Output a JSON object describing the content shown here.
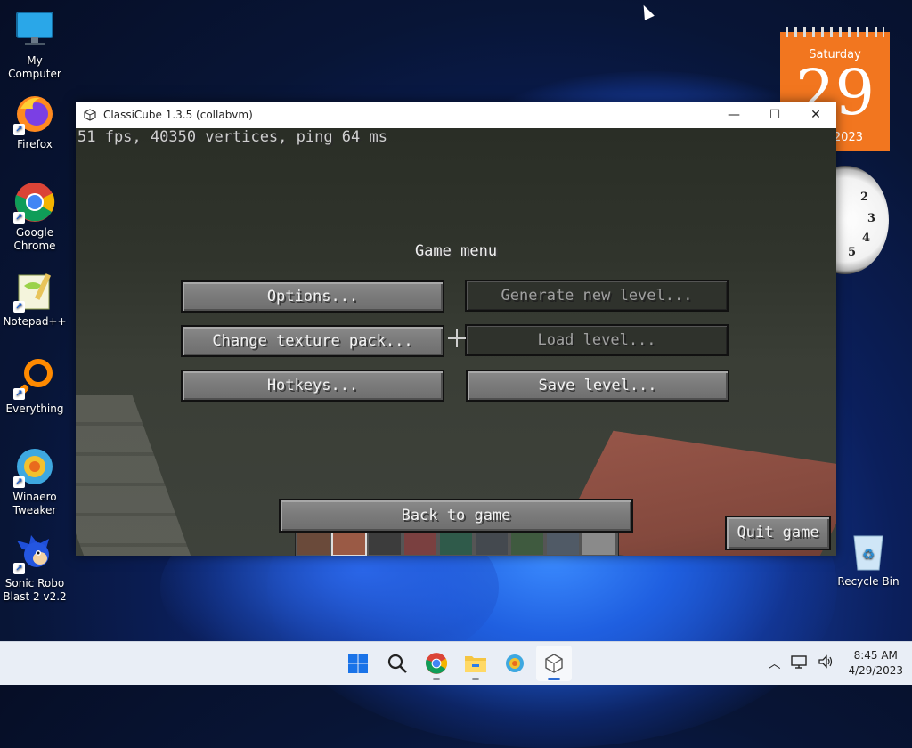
{
  "desktop": {
    "icons": [
      {
        "label": "My Computer"
      },
      {
        "label": "Firefox"
      },
      {
        "label": "Google Chrome"
      },
      {
        "label": "Notepad++"
      },
      {
        "label": "Everything"
      },
      {
        "label": "Winaero Tweaker"
      },
      {
        "label": "Sonic Robo Blast 2 v2.2"
      },
      {
        "label": "Recycle Bin"
      }
    ],
    "calendar": {
      "weekday": "Saturday",
      "day": "29",
      "year": "2023"
    },
    "clock_numbers": [
      "2",
      "3",
      "4",
      "5"
    ]
  },
  "window": {
    "title": "ClassiCube 1.3.5 (collabvm)",
    "minimize": "—",
    "maximize": "☐",
    "close": "✕"
  },
  "game": {
    "fps_text": "51 fps, 40350 vertices, ping 64 ms",
    "menu_title": "Game menu",
    "buttons": {
      "options": "Options...",
      "generate": "Generate new level...",
      "texture": "Change texture pack...",
      "load": "Load level...",
      "hotkeys": "Hotkeys...",
      "save": "Save level...",
      "back": "Back to game",
      "quit": "Quit game"
    }
  },
  "taskbar": {
    "time": "8:45 AM",
    "date": "4/29/2023",
    "apps": [
      "start-icon",
      "search-icon",
      "chrome-icon",
      "file-explorer-icon",
      "winaero-icon",
      "classicube-icon"
    ]
  },
  "colors": {
    "calendar": "#f2761f",
    "taskbar": "#e9eef6",
    "mc_button": "#7a7a7a",
    "mc_button_disabled": "#2f322c"
  }
}
